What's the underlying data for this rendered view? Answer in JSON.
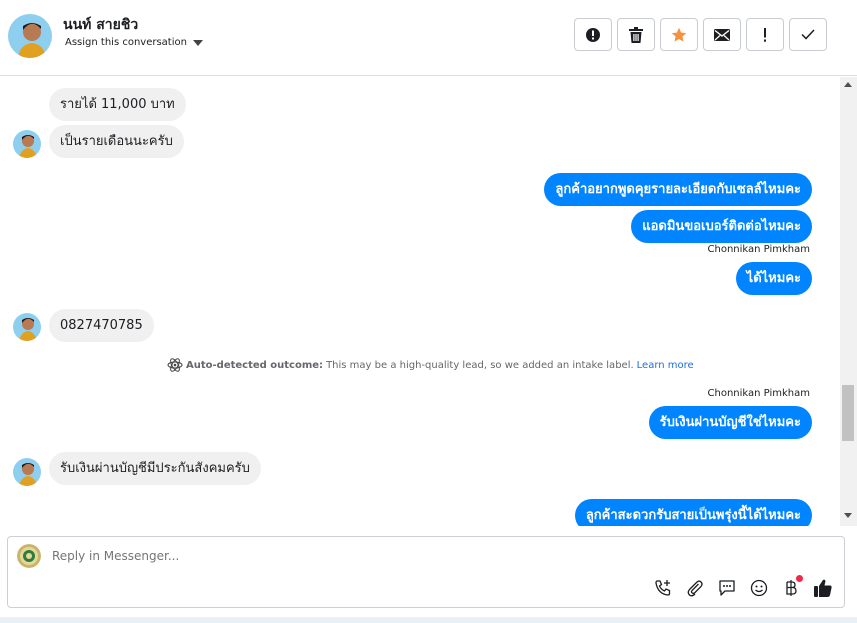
{
  "header": {
    "contact_name": "นนท์ สายชิว",
    "assign_label": "Assign this conversation",
    "actions": [
      {
        "icon": "exclamation-circle-icon",
        "name": "mark-spam-button"
      },
      {
        "icon": "trash-icon",
        "name": "delete-button"
      },
      {
        "icon": "star-icon",
        "name": "star-button",
        "color": "#f7923b"
      },
      {
        "icon": "envelope-icon",
        "name": "mark-unread-button"
      },
      {
        "icon": "exclamation-icon",
        "name": "follow-up-button"
      },
      {
        "icon": "check-icon",
        "name": "mark-done-button"
      }
    ]
  },
  "messages": {
    "items": [
      {
        "dir": "in",
        "text": "รายได้ 11,000 บาท"
      },
      {
        "dir": "in",
        "text": "เป็นรายเดือนนะครับ"
      },
      {
        "dir": "out",
        "text": "ลูกค้าอยากพูดคุยรายละเอียดกับเซลล์ไหมคะ"
      },
      {
        "dir": "out",
        "text": "แอดมินขอเบอร์ติดต่อไหมคะ"
      },
      {
        "dir": "out",
        "text": "ได้ไหมคะ",
        "sender": "Chonnikan Pimkham"
      },
      {
        "dir": "in",
        "text": "0827470785"
      },
      {
        "dir": "out",
        "text": "รับเงินผ่านบัญชีใช่ไหมคะ",
        "sender": "Chonnikan Pimkham"
      },
      {
        "dir": "in",
        "text": "รับเงินผ่านบัญชีมีประกันสังคมครับ"
      },
      {
        "dir": "out",
        "text": "ลูกค้าสะดวกรับสายเป็นพรุ่งนี้ได้ไหมคะ"
      }
    ],
    "outcome": {
      "label": "Auto-detected outcome:",
      "text": "This may be a high-quality lead, so we added an intake label.",
      "link": "Learn more"
    }
  },
  "composer": {
    "placeholder": "Reply in Messenger...",
    "tools": [
      "phone-add-icon",
      "paperclip-icon",
      "saved-reply-icon",
      "emoji-icon",
      "baht-payment-icon",
      "thumbs-up-icon"
    ]
  },
  "colors": {
    "outgoing_bubble": "#0084ff",
    "incoming_bubble": "#f0f0f0",
    "link": "#216fdb",
    "notification_dot": "#f02849"
  }
}
